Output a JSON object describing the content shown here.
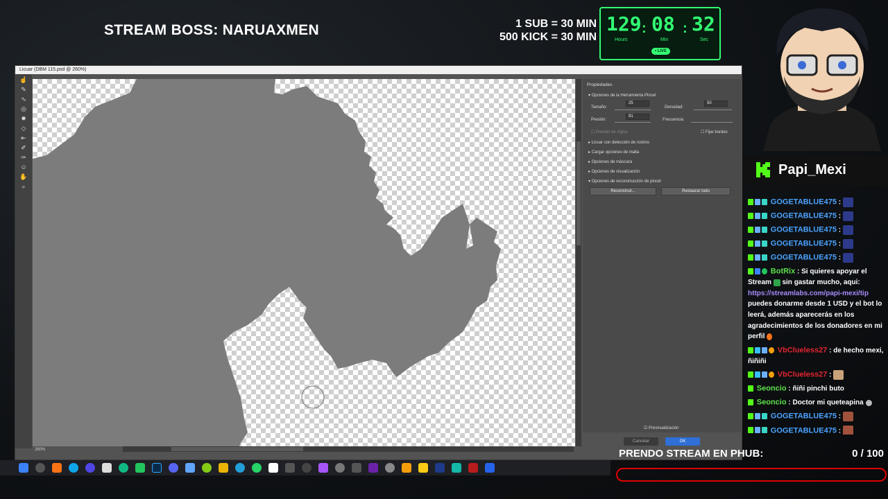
{
  "overlay": {
    "boss_text": "STREAM BOSS: NARUAXMEN",
    "sub_rule_1": "1 SUB = 30 MIN",
    "sub_rule_2": "500 KICK = 30 MIN",
    "timer": {
      "hours": "129",
      "minutes": "08",
      "seconds": "32",
      "hours_label": "Hours",
      "minutes_label": "Min",
      "seconds_label": "Sec",
      "live_label": "• LIVE"
    },
    "streamer_name": "Papi_Mexi",
    "goal_text": "PRENDO STREAM EN PHUB:",
    "goal_count": "0 / 100",
    "goal_progress": 0,
    "accent_green": "#33ff73",
    "goal_red": "#e00000"
  },
  "chat": {
    "messages": [
      {
        "user": "GOGETABLUE475",
        "sep": " :",
        "color": "blue"
      },
      {
        "user": "GOGETABLUE475",
        "sep": " :",
        "color": "blue"
      },
      {
        "user": "GOGETABLUE475",
        "sep": " :",
        "color": "blue"
      },
      {
        "user": "GOGETABLUE475",
        "sep": " :",
        "color": "blue"
      },
      {
        "user": "GOGETABLUE475",
        "sep": " :",
        "color": "blue"
      },
      {
        "user": "BotRix",
        "sep": " :",
        "color": "green",
        "text_1": "Si quieres apoyar el Stream",
        "text_2": "sin gastar mucho, aqui:",
        "link": "https://streamlabs.com/papi-mexi/tip",
        "text_3": "puedes donarme desde 1 USD y el bot lo leerá, además aparecerás en los agradecimientos de los donadores en mi perfil"
      },
      {
        "user": "VbClueless27",
        "sep": " :",
        "color": "red",
        "text_1": "de hecho mexi, ñiñiñi"
      },
      {
        "user": "VbClueless27",
        "sep": " :",
        "color": "red"
      },
      {
        "user": "Seoncio",
        "sep": " :",
        "color": "green",
        "text_1": "ñiñi pinchi buto"
      },
      {
        "user": "Seoncio",
        "sep": " :",
        "color": "green",
        "text_1": "Doctor mi queteapina"
      },
      {
        "user": "GOGETABLUE475",
        "sep": " :",
        "color": "blue"
      },
      {
        "user": "GOGETABLUE475",
        "sep": " :",
        "color": "blue"
      }
    ]
  },
  "photoshop": {
    "title": "Licuar (DBM 115.psd @ 260%)",
    "zoom": "260%",
    "panel_title": "Propiedades",
    "section_brush": "Opciones de la Herramienta Pincel",
    "size_label": "Tamaño:",
    "size_value": "25",
    "density_label": "Densidad:",
    "density_value": "50",
    "pressure_label": "Presión:",
    "pressure_value": "91",
    "frequency_label": "Frecuencia:",
    "stylus_label": "Presión de stylus",
    "pin_edges_label": "Fijar bordes",
    "sections": [
      "Licuar con detección de rostros",
      "Cargar opciones de malla",
      "Opciones de máscara",
      "Opciones de visualización",
      "Opciones de reconstrucción de pincel"
    ],
    "reconstruct_label": "Reconstruir...",
    "restore_label": "Restaurar todo",
    "preview_label": "Previsualización",
    "cancel_label": "Cancelar",
    "ok_label": "OK"
  }
}
